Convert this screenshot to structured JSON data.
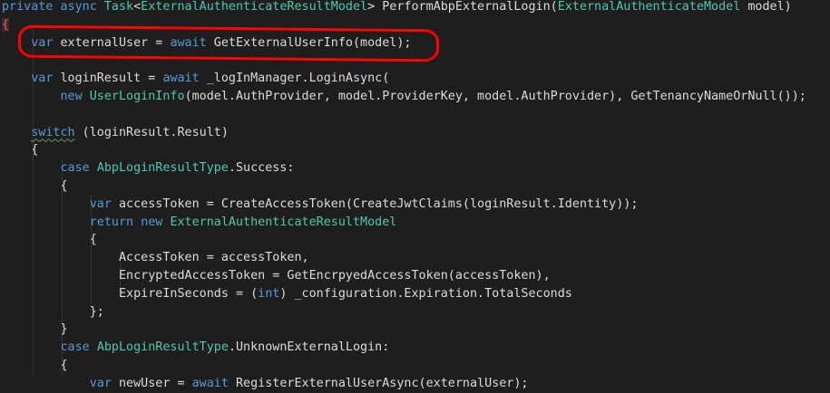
{
  "colors": {
    "background": "#1e1e1e",
    "keyword": "#569cd6",
    "type": "#4ec9b0",
    "identifier": "#dcdcdc",
    "annotation": "#ff0000",
    "brace_highlight": "#c0504d"
  },
  "code": {
    "lines": [
      [
        [
          "kw",
          "private"
        ],
        [
          "t",
          " "
        ],
        [
          "kw",
          "async"
        ],
        [
          "t",
          " "
        ],
        [
          "ty",
          "Task"
        ],
        [
          "t",
          "<"
        ],
        [
          "ty",
          "ExternalAuthenticateResultModel"
        ],
        [
          "t",
          "> PerformAbpExternalLogin("
        ],
        [
          "ty",
          "ExternalAuthenticateModel"
        ],
        [
          "t",
          " model)"
        ]
      ],
      [
        [
          "br",
          "{"
        ]
      ],
      [
        [
          "t",
          "    "
        ],
        [
          "kw",
          "var"
        ],
        [
          "t",
          " externalUser = "
        ],
        [
          "kw",
          "await"
        ],
        [
          "t",
          " GetExternalUserInfo(model);"
        ]
      ],
      [],
      [
        [
          "t",
          "    "
        ],
        [
          "kw",
          "var"
        ],
        [
          "t",
          " loginResult = "
        ],
        [
          "kw",
          "await"
        ],
        [
          "t",
          " _logInManager.LoginAsync("
        ]
      ],
      [
        [
          "t",
          "        "
        ],
        [
          "kw",
          "new"
        ],
        [
          "t",
          " "
        ],
        [
          "ty",
          "UserLoginInfo"
        ],
        [
          "t",
          "(model.AuthProvider, model.ProviderKey, model.AuthProvider), GetTenancyNameOrNull());"
        ]
      ],
      [],
      [
        [
          "t",
          "    "
        ],
        [
          "kwsq",
          "switch"
        ],
        [
          "t",
          " (loginResult.Result)"
        ]
      ],
      [
        [
          "t",
          "    {"
        ]
      ],
      [
        [
          "t",
          "        "
        ],
        [
          "kw",
          "case"
        ],
        [
          "t",
          " "
        ],
        [
          "ty",
          "AbpLoginResultType"
        ],
        [
          "t",
          ".Success:"
        ]
      ],
      [
        [
          "t",
          "        {"
        ]
      ],
      [
        [
          "t",
          "            "
        ],
        [
          "kw",
          "var"
        ],
        [
          "t",
          " accessToken = CreateAccessToken(CreateJwtClaims(loginResult.Identity));"
        ]
      ],
      [
        [
          "t",
          "            "
        ],
        [
          "kw",
          "return"
        ],
        [
          "t",
          " "
        ],
        [
          "kw",
          "new"
        ],
        [
          "t",
          " "
        ],
        [
          "ty",
          "ExternalAuthenticateResultModel"
        ]
      ],
      [
        [
          "t",
          "            {"
        ]
      ],
      [
        [
          "t",
          "                AccessToken = accessToken,"
        ]
      ],
      [
        [
          "t",
          "                EncryptedAccessToken = GetEncrpyedAccessToken(accessToken),"
        ]
      ],
      [
        [
          "t",
          "                ExpireInSeconds = ("
        ],
        [
          "kw",
          "int"
        ],
        [
          "t",
          ") _configuration.Expiration.TotalSeconds"
        ]
      ],
      [
        [
          "t",
          "            };"
        ]
      ],
      [
        [
          "t",
          "        }"
        ]
      ],
      [
        [
          "t",
          "        "
        ],
        [
          "kw",
          "case"
        ],
        [
          "t",
          " "
        ],
        [
          "ty",
          "AbpLoginResultType"
        ],
        [
          "t",
          ".UnknownExternalLogin:"
        ]
      ],
      [
        [
          "t",
          "        {"
        ]
      ],
      [
        [
          "t",
          "            "
        ],
        [
          "kw",
          "var"
        ],
        [
          "t",
          " newUser = "
        ],
        [
          "kw",
          "await"
        ],
        [
          "t",
          " RegisterExternalUserAsync(externalUser);"
        ]
      ]
    ]
  }
}
